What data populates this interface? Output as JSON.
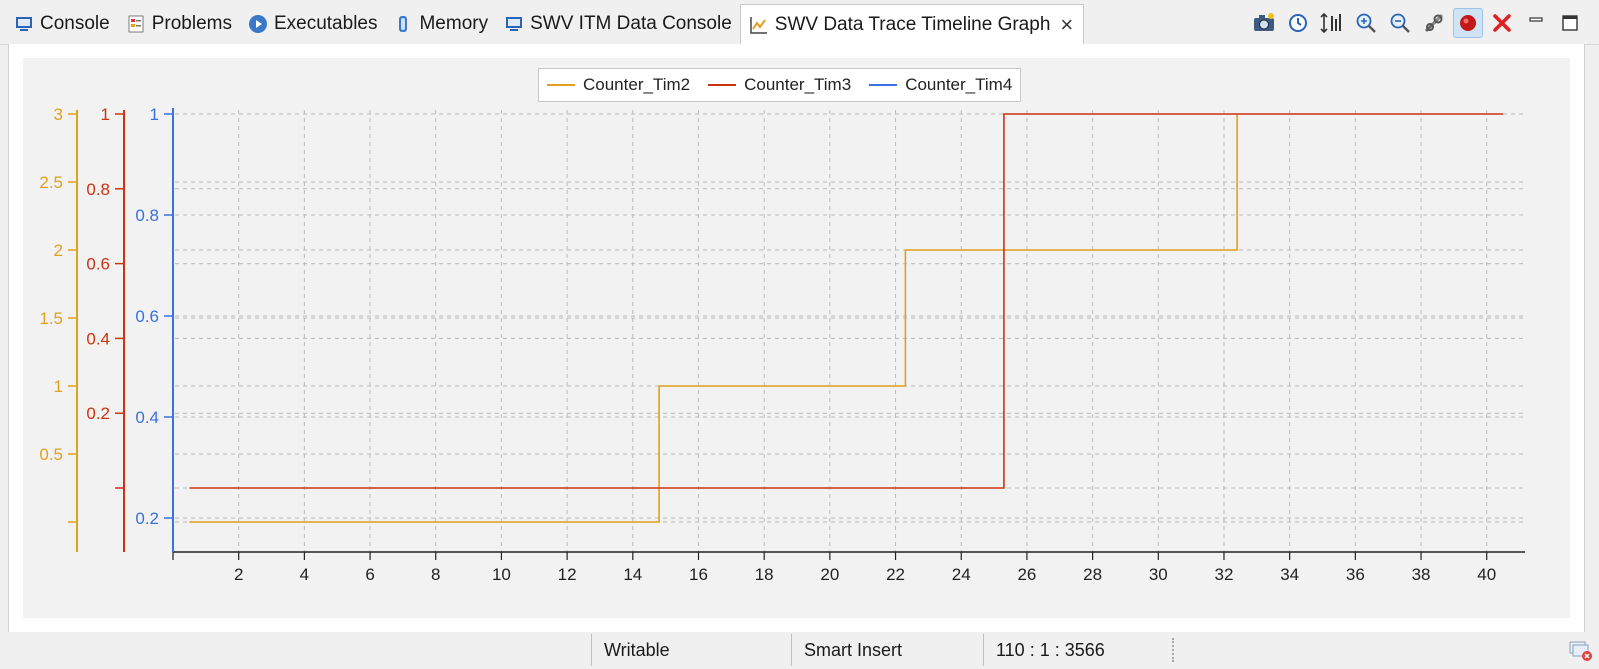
{
  "tabs": [
    {
      "label": "Console",
      "icon": "console-icon"
    },
    {
      "label": "Problems",
      "icon": "problems-icon"
    },
    {
      "label": "Executables",
      "icon": "executables-icon"
    },
    {
      "label": "Memory",
      "icon": "memory-icon"
    },
    {
      "label": "SWV ITM Data Console",
      "icon": "itm-console-icon"
    },
    {
      "label": "SWV Data Trace Timeline Graph",
      "icon": "timeline-graph-icon",
      "active": true
    }
  ],
  "toolbar": [
    "snapshot-icon",
    "clock-icon",
    "adjust-y-axis-icon",
    "zoom-in-icon",
    "zoom-out-icon",
    "configure-trace-icon",
    "start-trace-icon",
    "remove-all-icon",
    "minimize-icon",
    "maximize-icon"
  ],
  "colors": {
    "tim2": "#e0a020",
    "tim3": "#cc3311",
    "tim4": "#3a6fe6",
    "grid": "#b9b9b9",
    "active_tab": "#ffffff",
    "chart_bg": "#f2f2f2"
  },
  "chart_data": {
    "type": "line",
    "step": true,
    "legend_position": "top-center",
    "grid": true,
    "series": [
      {
        "name": "Counter_Tim2",
        "color": "#e0a020",
        "axis": "y1",
        "x": [
          0.5,
          14.8,
          14.8,
          22.3,
          22.3,
          32.4,
          32.4
        ],
        "y": [
          0,
          0,
          1,
          1,
          2,
          2,
          3
        ]
      },
      {
        "name": "Counter_Tim3",
        "color": "#cc3311",
        "axis": "y2",
        "x": [
          0.5,
          25.3,
          25.3,
          40.5
        ],
        "y": [
          0,
          0,
          1,
          1
        ]
      },
      {
        "name": "Counter_Tim4",
        "color": "#3a6fe6",
        "axis": "y3",
        "x": [],
        "y": []
      }
    ],
    "x_axis": {
      "ticks": [
        "2",
        "4",
        "6",
        "8",
        "10",
        "12",
        "14",
        "16",
        "18",
        "20",
        "22",
        "24",
        "26",
        "28",
        "30",
        "32",
        "34",
        "36",
        "38",
        "40"
      ],
      "min": 0,
      "max": 40.8
    },
    "y_axes": [
      {
        "id": "y1",
        "color": "#e0a020",
        "min": 0,
        "max": 3,
        "ticks": [
          "0.5",
          "1",
          "1.5",
          "2",
          "2.5",
          "3"
        ]
      },
      {
        "id": "y2",
        "color": "#cc3311",
        "min": 0,
        "max": 1,
        "ticks": [
          "0.2",
          "0.4",
          "0.6",
          "0.8",
          "1"
        ]
      },
      {
        "id": "y3",
        "color": "#3a6fe6",
        "min": 0.13,
        "max": 1,
        "ticks": [
          "0.2",
          "0.4",
          "0.6",
          "0.8",
          "1"
        ]
      }
    ]
  },
  "status": {
    "writable": "Writable",
    "insert_mode": "Smart Insert",
    "position": "110 : 1 : 3566"
  }
}
